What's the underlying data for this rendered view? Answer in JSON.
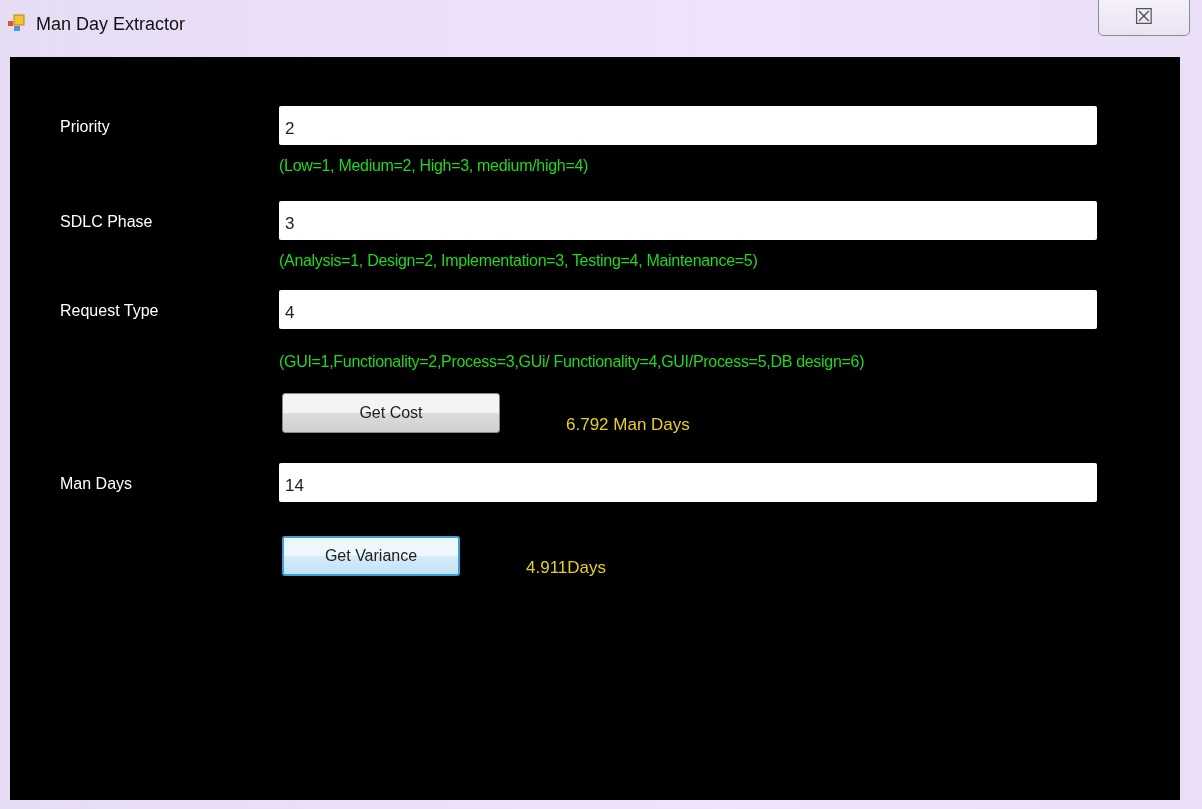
{
  "window": {
    "title": "Man Day Extractor",
    "close": "☒"
  },
  "rows": [
    {
      "kind": "field",
      "label": "Priority",
      "value": "2",
      "hint": "(Low=1, Medium=2, High=3, medium/high=4)"
    },
    {
      "kind": "field",
      "label": "SDLC Phase",
      "value": "3",
      "hint": "(Analysis=1, Design=2, Implementation=3, Testing=4, Maintenance=5)"
    },
    {
      "kind": "field",
      "label": "Request Type",
      "value": "4",
      "hint": "(GUI=1,Functionality=2,Process=3,GUi/ Functionality=4,GUI/Process=5,DB design=6)"
    },
    {
      "kind": "action",
      "button": "Get Cost",
      "result": "6.792 Man Days",
      "focused": false
    },
    {
      "kind": "field",
      "label": "Man Days",
      "value": "14"
    },
    {
      "kind": "action",
      "button": "Get Variance",
      "result": "4.911Days",
      "focused": true
    }
  ]
}
